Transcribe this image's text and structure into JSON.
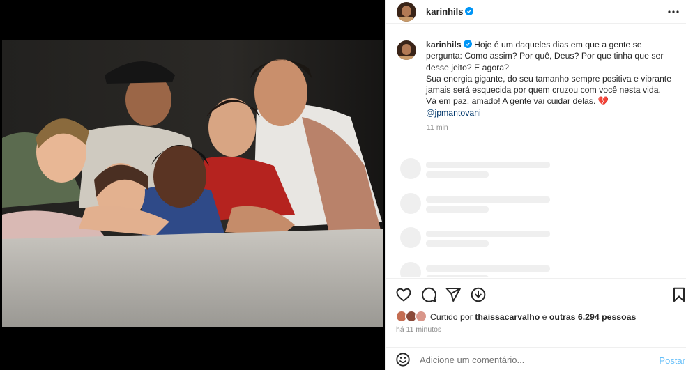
{
  "post": {
    "username": "karinhils",
    "verified": true,
    "photo_alt": "",
    "caption": {
      "username": "karinhils",
      "lines": [
        "Hoje é um daqueles dias em que a gente se",
        "pergunta: Como assim? Por quê, Deus? Por que tinha que ser",
        "desse jeito? E agora?",
        "Sua energia gigante, do seu tamanho sempre positiva e vibrante",
        "jamais será esquecida por quem cruzou com você nesta vida.",
        "Vá em paz, amado! A gente vai cuidar delas."
      ],
      "first_line_prefix": "Hoje é um daqueles dias em que a gente se",
      "heart": "💔",
      "mention": "@jpmantovani",
      "time": "11 min"
    },
    "likes": {
      "prefix": "Curtido por",
      "user": "thaissacarvalho",
      "middle": "e",
      "others": "outras 6.294 pessoas"
    },
    "posted_ago": "há 11 minutos",
    "comment": {
      "placeholder": "Adicione um comentário...",
      "post_label": "Postar"
    }
  },
  "icons": {
    "more": "more-horizontal-icon",
    "like": "heart-outline-icon",
    "comment": "comment-bubble-icon",
    "share": "paper-plane-icon",
    "download": "download-circle-icon",
    "save": "bookmark-icon",
    "emoji": "smiley-icon",
    "verified": "verified-badge-icon"
  },
  "colors": {
    "link": "#00376b",
    "accent": "#0095f6",
    "verified": "#0095f6",
    "muted": "#8e8e8e",
    "skeleton": "#efefef"
  }
}
